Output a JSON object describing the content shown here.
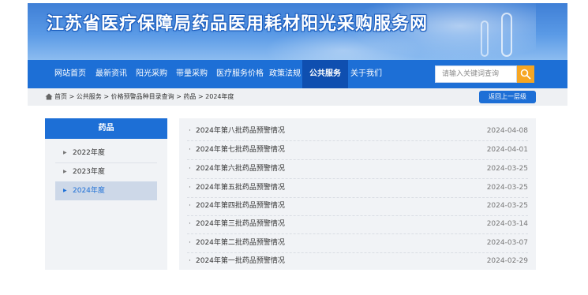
{
  "header": {
    "site_title": "江苏省医疗保障局药品医用耗材阳光采购服务网"
  },
  "nav": {
    "items": [
      "网站首页",
      "最新资讯",
      "阳光采购",
      "带量采购",
      "医疗服务价格",
      "政策法规",
      "公共服务",
      "关于我们"
    ],
    "active": "公共服务",
    "search_placeholder": "请输入关键词查询"
  },
  "breadcrumb": {
    "text": "首页 > 公共服务 > 价格预警品种目录查询 > 药品 > 2024年度",
    "back_label": "返回上一层级"
  },
  "sidebar": {
    "heading": "药品",
    "items": [
      "2022年度",
      "2023年度",
      "2024年度"
    ],
    "active": "2024年度"
  },
  "list": [
    {
      "title": "2024年第八批药品预警情况",
      "date": "2024-04-08"
    },
    {
      "title": "2024年第七批药品预警情况",
      "date": "2024-04-01"
    },
    {
      "title": "2024年第六批药品预警情况",
      "date": "2024-03-25"
    },
    {
      "title": "2024年第五批药品预警情况",
      "date": "2024-03-25"
    },
    {
      "title": "2024年第四批药品预警情况",
      "date": "2024-03-25"
    },
    {
      "title": "2024年第三批药品预警情况",
      "date": "2024-03-14"
    },
    {
      "title": "2024年第二批药品预警情况",
      "date": "2024-03-07"
    },
    {
      "title": "2024年第一批药品预警情况",
      "date": "2024-02-29"
    }
  ],
  "colors": {
    "primary": "#1d6fd6",
    "nav_active": "#0f4fb0",
    "search_button": "#f6a623",
    "panel_bg": "#f1f3f6"
  }
}
